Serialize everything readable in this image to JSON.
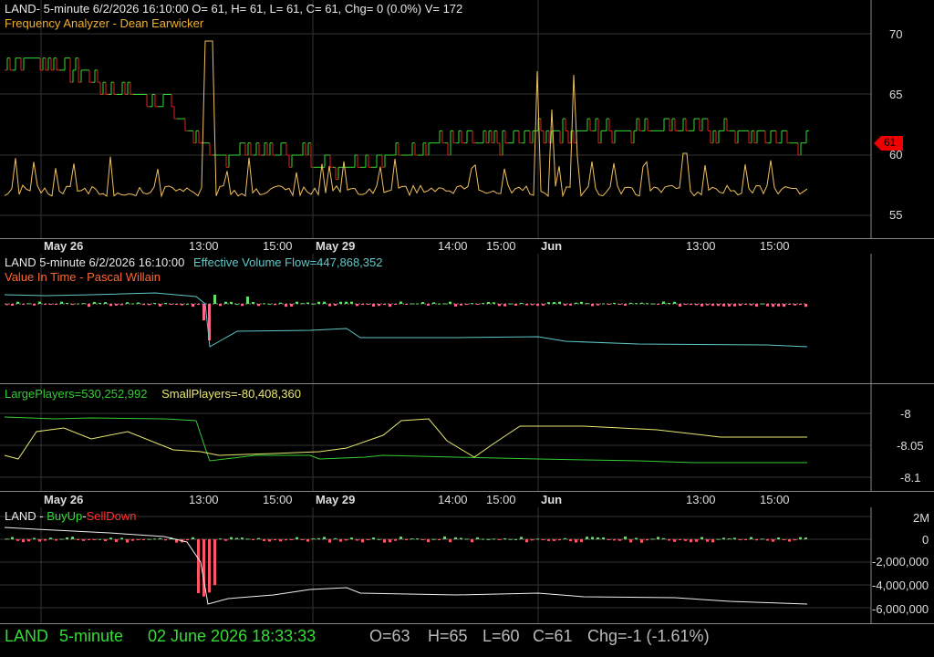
{
  "pane1": {
    "header": "LAND- 5-minute 6/2/2026 16:10:00 O= 61, H= 61, L= 61, C= 61, Chg= 0 (0.0%) V= 172",
    "indicator": "Frequency Analyzer - Dean Earwicker",
    "y_ticks": [
      "70",
      "65",
      "60",
      "55"
    ],
    "price_tag": "61",
    "colors": {
      "up": "#33dd33",
      "down": "#dd2222",
      "indicator": "#f0c060",
      "tag": "#ee0000"
    }
  },
  "dates_top": [
    "May 26",
    "13:00",
    "15:00",
    "May 29",
    "14:00",
    "15:00",
    "Jun",
    "13:00",
    "15:00"
  ],
  "pane2": {
    "header": "LAND 5-minute  6/2/2026 16:10:00",
    "evf": "Effective Volume Flow=447,868,352",
    "vit": "Value In Time - Pascal Willain",
    "colors": {
      "evf": "#5fc8c8",
      "vit": "#ff6633"
    }
  },
  "pane3": {
    "large": "LargePlayers=530,252,992",
    "small": "SmallPlayers=-80,408,360",
    "y_ticks": [
      "-8",
      "-8.05",
      "-8.1"
    ],
    "colors": {
      "large": "#33cc33",
      "small": "#e8e870"
    }
  },
  "dates_bottom": [
    "May 26",
    "13:00",
    "15:00",
    "May 29",
    "14:00",
    "15:00",
    "Jun",
    "13:00",
    "15:00"
  ],
  "pane4": {
    "land": "LAND - ",
    "buyup": "BuyUp",
    "dash": "-",
    "selldown": "SellDown",
    "y_ticks": [
      "2M",
      "0",
      "-2,000,000",
      "-4,000,000",
      "-6,000,000"
    ],
    "colors": {
      "buyup": "#33dd33",
      "selldown": "#ff3333"
    }
  },
  "status": {
    "symbol": "LAND",
    "interval": "5-minute",
    "datetime": "02 June 2026 18:33:33",
    "open": "O=63",
    "high": "H=65",
    "low": "L=60",
    "close": "C=61",
    "chg": "Chg=-1 (-1.61%)"
  }
}
